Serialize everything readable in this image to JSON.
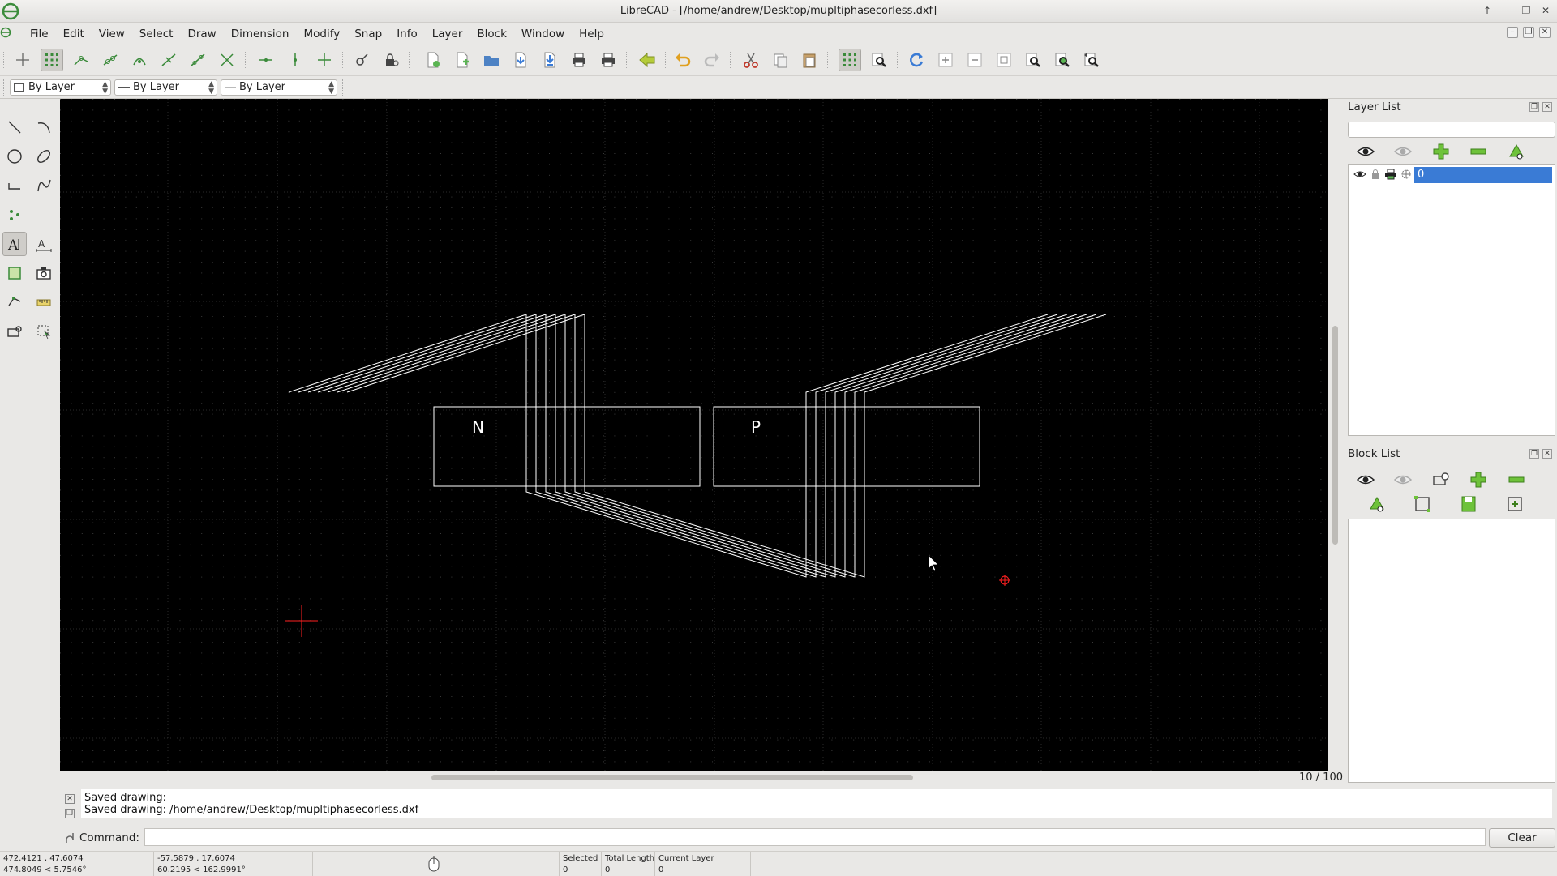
{
  "window": {
    "title": "LibreCAD - [/home/andrew/Desktop/mupltiphasecorless.dxf]"
  },
  "menu": [
    "File",
    "Edit",
    "View",
    "Select",
    "Draw",
    "Dimension",
    "Modify",
    "Snap",
    "Info",
    "Layer",
    "Block",
    "Window",
    "Help"
  ],
  "properties": {
    "color": "By Layer",
    "linetype": "By Layer",
    "linewidth": "By Layer"
  },
  "drawing": {
    "label_n": "N",
    "label_p": "P"
  },
  "zoom": "10 / 100",
  "layer_list": {
    "title": "Layer List",
    "layers": [
      {
        "name": "0"
      }
    ]
  },
  "block_list": {
    "title": "Block List"
  },
  "command": {
    "history": [
      "Saved drawing:",
      "Saved drawing: /home/andrew/Desktop/mupltiphasecorless.dxf"
    ],
    "label": "Command:",
    "clear_label": "Clear"
  },
  "status": {
    "abs_coord_1": "472.4121 , 47.6074",
    "abs_coord_2": "474.8049 < 5.7546°",
    "rel_coord_1": "-57.5879 , 17.6074",
    "rel_coord_2": "60.2195 < 162.9991°",
    "selected_label": "Selected",
    "selected_value": "0",
    "total_length_label": "Total Length",
    "total_length_value": "0",
    "current_layer_label": "Current Layer",
    "current_layer_value": "0"
  },
  "colors": {
    "canvas_bg": "#000000",
    "entity": "#ffffff",
    "selection": "#3a7bd5",
    "crosshair": "#ff0000"
  }
}
